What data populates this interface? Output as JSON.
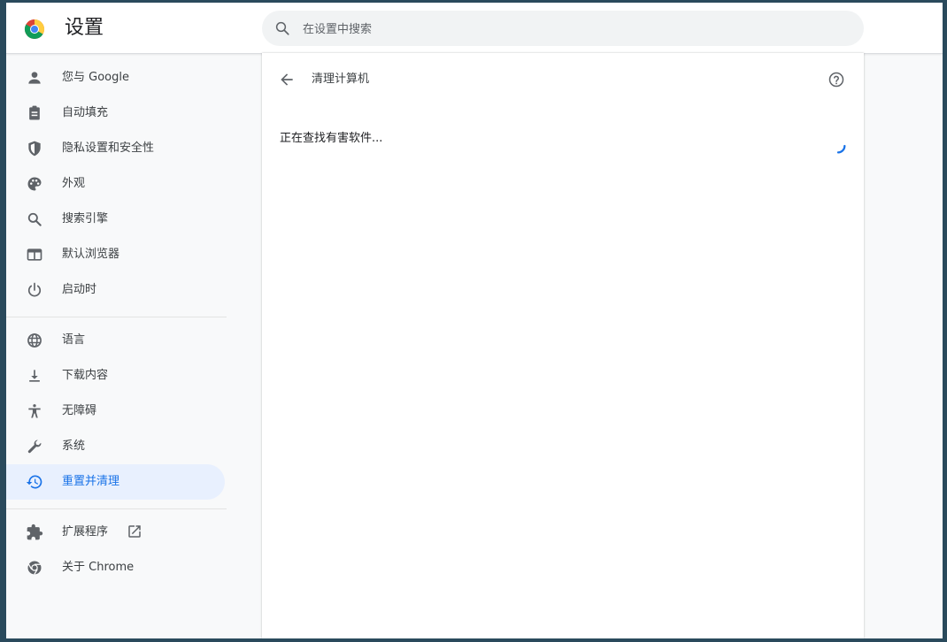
{
  "header": {
    "title": "设置",
    "search_placeholder": "在设置中搜索"
  },
  "sidebar": {
    "items": [
      {
        "label": "您与 Google",
        "icon": "person-icon"
      },
      {
        "label": "自动填充",
        "icon": "clipboard-icon"
      },
      {
        "label": "隐私设置和安全性",
        "icon": "shield-icon"
      },
      {
        "label": "外观",
        "icon": "palette-icon"
      },
      {
        "label": "搜索引擎",
        "icon": "search-icon"
      },
      {
        "label": "默认浏览器",
        "icon": "browser-window-icon"
      },
      {
        "label": "启动时",
        "icon": "power-icon"
      },
      {
        "label": "语言",
        "icon": "globe-icon"
      },
      {
        "label": "下载内容",
        "icon": "download-icon"
      },
      {
        "label": "无障碍",
        "icon": "accessibility-icon"
      },
      {
        "label": "系统",
        "icon": "wrench-icon"
      },
      {
        "label": "重置并清理",
        "icon": "restore-icon",
        "active": true
      },
      {
        "label": "扩展程序",
        "icon": "puzzle-icon"
      },
      {
        "label": "关于 Chrome",
        "icon": "chrome-icon"
      }
    ]
  },
  "main": {
    "page_title": "清理计算机",
    "status_text": "正在查找有害软件..."
  },
  "colors": {
    "accent": "#1a73e8",
    "active_bg": "#e8f0fe",
    "icon": "#5f6368"
  }
}
